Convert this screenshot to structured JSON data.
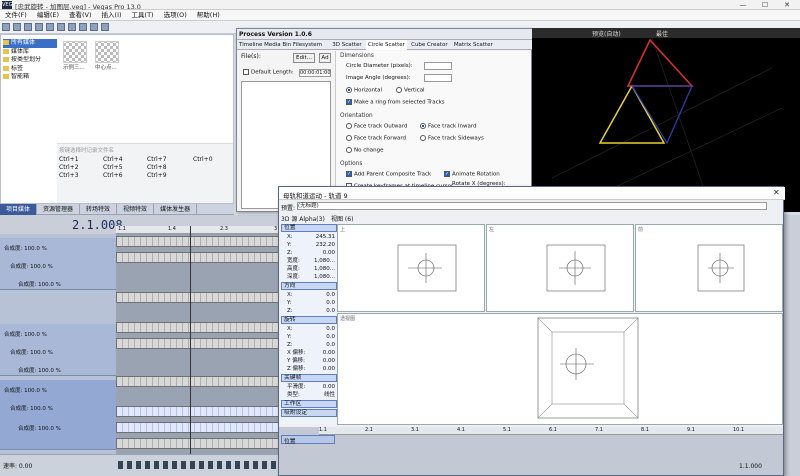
{
  "window": {
    "title": "[忠武旋转 - 加图层.veg] - Vegas Pro 13.0",
    "logo": "VEGAS",
    "controls": [
      "—",
      "☐",
      "✕"
    ]
  },
  "menu": [
    "文件(F)",
    "编辑(E)",
    "查看(V)",
    "插入(I)",
    "工具(T)",
    "选项(O)",
    "帮助(H)"
  ],
  "explorer": {
    "tree": [
      "所有媒体",
      "媒体库",
      "按类型划分",
      "标签",
      "智能箱"
    ],
    "thumbs": [
      "示例三...",
      "中心点..."
    ],
    "search_hint": "按键选择时记录文件名",
    "keys": [
      "Ctrl+1",
      "Ctrl+4",
      "Ctrl+7",
      "Ctrl+0",
      "Ctrl+2",
      "Ctrl+5",
      "Ctrl+8",
      "Ctrl+3",
      "Ctrl+6",
      "Ctrl+9"
    ]
  },
  "doc_tabs": [
    "项目媒体",
    "资源管理器",
    "转场特效",
    "视频特效",
    "媒体发生器"
  ],
  "timeline": {
    "timecode": "2.1.008",
    "ruler": [
      "1.1",
      "1.4",
      "2.3",
      "3"
    ],
    "tracks": [
      {
        "level": "合成度: 100.0 %",
        "sub1": "合成度: 100.0 %",
        "sub2": "合成度: 100.0 %"
      },
      {
        "level": "合成度: 100.0 %",
        "sub1": "合成度: 100.0 %",
        "sub2": "合成度: 100.0 %"
      },
      {
        "level": "合成度: 100.0 %",
        "sub1": "合成度: 100.0 %",
        "sub2": "合成度: 100.0 %"
      }
    ],
    "rate": "速率: 0.00"
  },
  "process": {
    "title": "Process  Version 1.0.6",
    "tabs": [
      "Timeline Media Bin Filesystem",
      "3D Scatter",
      "Circle Scatter",
      "Cube Creator",
      "Matrix Scatter"
    ],
    "files_label": "File(s):",
    "edit_btn": "Edit...",
    "add_btn": "Ad",
    "default_length": "Default Length:",
    "default_length_value": "00:00:01:00",
    "dimensions": "Dimensions",
    "circle_diameter": "Circle Diameter (pixels):",
    "image_angle": "Image Angle (degrees):",
    "horizontal": "Horizontal",
    "vertical": "Vertical",
    "make_ring": "Make a ring from selected Tracks",
    "orientation": "Orientation",
    "face_outward": "Face track Outward",
    "face_inward": "Face track Inward",
    "face_forward": "Face track Forward",
    "face_sideways": "Face track Sideways",
    "no_change": "No change",
    "options": "Options",
    "add_parent": "Add Parent Composite Track",
    "animate_rotation": "Animate Rotation",
    "rotate_x": "Rotate X (degrees):",
    "create_keyframes": "Create keyframes at timeline cursor"
  },
  "preview": {
    "label": "预览(自动)",
    "mode": "最佳"
  },
  "motion": {
    "title": "母轨和道运动 - 轨道 9",
    "preset_label": "预置:",
    "preset_value": "(无标题)",
    "mode_label": "3D 源 Alpha(3)",
    "view_label": "视图 (6)",
    "sections": {
      "position": "位置",
      "orientation": "方向",
      "rotation": "旋转",
      "keyframe": "关键帧",
      "layout": "工作区",
      "adsorb": "吸附设定"
    },
    "position_rows": [
      {
        "k": "X:",
        "v": "245.31"
      },
      {
        "k": "Y:",
        "v": "232.20"
      },
      {
        "k": "Z:",
        "v": "0.00"
      },
      {
        "k": "宽度:",
        "v": "1,080..."
      },
      {
        "k": "高度:",
        "v": "1,080..."
      },
      {
        "k": "深度:",
        "v": "1,080..."
      }
    ],
    "orientation_rows": [
      {
        "k": "X:",
        "v": "0.0"
      },
      {
        "k": "Y:",
        "v": "0.0"
      },
      {
        "k": "Z:",
        "v": "0.0"
      }
    ],
    "rotation_rows": [
      {
        "k": "X:",
        "v": "0.0"
      },
      {
        "k": "Y:",
        "v": "0.0"
      },
      {
        "k": "Z:",
        "v": "0.0"
      },
      {
        "k": "X 偏移:",
        "v": "0.00"
      },
      {
        "k": "Y 偏移:",
        "v": "0.00"
      },
      {
        "k": "Z 偏移:",
        "v": "0.00"
      }
    ],
    "keyframe_rows": [
      {
        "k": "平滑度:",
        "v": "0.00"
      },
      {
        "k": "类型:",
        "v": "线性"
      }
    ],
    "views": [
      "上",
      "左",
      "前",
      "透视图"
    ],
    "timeline_label": "位置",
    "ruler": [
      "1.1",
      "2.1",
      "3.1",
      "4.1",
      "5.1",
      "6.1",
      "7.1",
      "8.1",
      "9.1",
      "10.1"
    ],
    "zoom": "1.1.000"
  }
}
